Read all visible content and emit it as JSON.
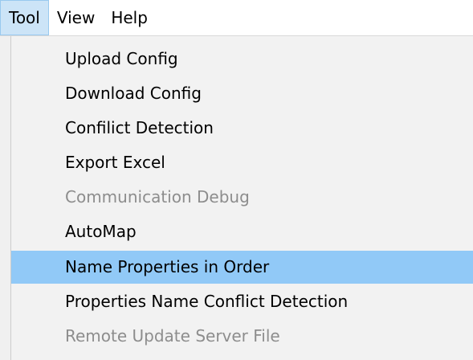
{
  "menubar": {
    "items": [
      {
        "label": "Tool",
        "active": true
      },
      {
        "label": "View",
        "active": false
      },
      {
        "label": "Help",
        "active": false
      }
    ]
  },
  "tool_menu": {
    "items": [
      {
        "label": "Upload Config",
        "enabled": true,
        "highlighted": false
      },
      {
        "label": "Download Config",
        "enabled": true,
        "highlighted": false
      },
      {
        "label": "Confilict Detection",
        "enabled": true,
        "highlighted": false
      },
      {
        "label": "Export Excel",
        "enabled": true,
        "highlighted": false
      },
      {
        "label": "Communication Debug",
        "enabled": false,
        "highlighted": false
      },
      {
        "label": "AutoMap",
        "enabled": true,
        "highlighted": false
      },
      {
        "label": "Name Properties in Order",
        "enabled": true,
        "highlighted": true
      },
      {
        "label": "Properties Name Conflict Detection",
        "enabled": true,
        "highlighted": false
      },
      {
        "label": "Remote Update Server File",
        "enabled": false,
        "highlighted": false
      }
    ]
  },
  "colors": {
    "menubar_active_bg": "#cce4f7",
    "item_highlight_bg": "#91c9f7",
    "disabled_text": "#8d8d8d"
  }
}
